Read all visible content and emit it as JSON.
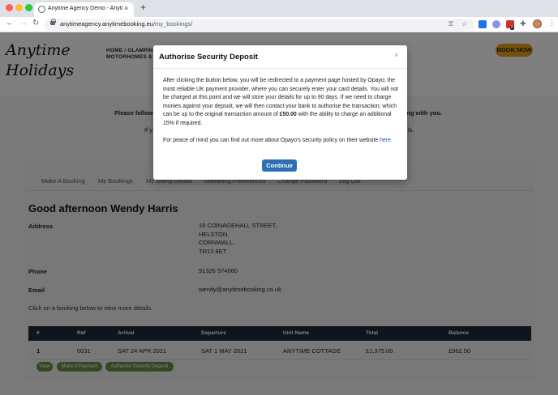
{
  "browser": {
    "tab_title": "Anytime Agency Demo - Anytime",
    "tab_close": "×",
    "new_tab": "+",
    "url_host": "anytimeagency.anytimebooking.eu",
    "url_path": "/my_bookings/",
    "back": "←",
    "forward": "→",
    "reload": "↻",
    "key_icon": "⚿",
    "star_icon": "☆",
    "ext_badge": "8",
    "extensions_icon": "✚",
    "menu": "⋮"
  },
  "site": {
    "logo_line1": "Anytime",
    "logo_line2": "Holidays",
    "nav_line1": "HOME   /   GLAMPING",
    "nav_line2": "MOTORHOMES & CAMPERVANS",
    "book_now": "BOOK NOW",
    "intro_left": "Please follow",
    "intro_right": "king with you.",
    "intro_left2": "If y",
    "intro_right2": "ls."
  },
  "account": {
    "tabs": [
      "Make A Booking",
      "My Bookings",
      "My Billing Details",
      "Marketing Preferences",
      "Change Password",
      "Log Out"
    ],
    "greeting": "Good afternoon Wendy Harris",
    "address_label": "Address",
    "address_lines": [
      "19 COINAGEHALL STREET,",
      "HELSTON,",
      "CORNWALL,",
      "TR13 8ET"
    ],
    "phone_label": "Phone",
    "phone": "91326 574660",
    "email_label": "Email",
    "email": "wendy@anytimebooking.co.uk",
    "hint": "Click on a booking below to view more details."
  },
  "bookings": {
    "columns": [
      "#",
      "Ref",
      "Arrival",
      "Departure",
      "Unit Name",
      "Total",
      "Balance"
    ],
    "rows": [
      [
        "1",
        "0031",
        "SAT 24 APR 2021",
        "SAT 1 MAY 2021",
        "ANYTIME COTTAGE",
        "£1,375.00",
        "£962.50"
      ]
    ],
    "actions": [
      "View",
      "Make A Payment",
      "Authorise Security Deposit"
    ]
  },
  "modal": {
    "title": "Authorise Security Deposit",
    "close": "×",
    "para1_before": "After clicking the button below, you will be redirected to a payment page hosted by Opayo; the most reliable UK payment provider, where you can securely enter your card details. You will not be charged at this point and we will store your details for up to 90 days. If we need to charge monies against your depsoit, we will then contact your bank to authorise the transaction; which can be up to the original transaction amount of ",
    "para1_amount": "£50.00",
    "para1_after": " with the ability to charge an additional 15% if required.",
    "para2": "For peace of mind you can find out more about Opayo's security policy on their website ",
    "para2_link": "here",
    "para2_end": ".",
    "continue": "Continue"
  }
}
